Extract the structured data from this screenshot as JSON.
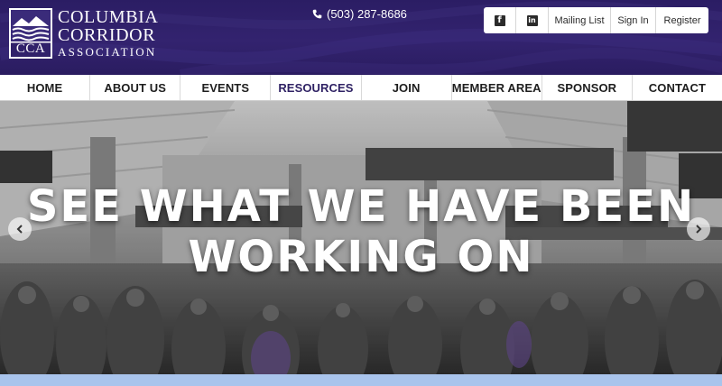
{
  "header": {
    "logo": {
      "abbr": "CCA",
      "line1": "COLUMBIA",
      "line2": "CORRIDOR",
      "line3": "ASSOCIATION"
    },
    "phone": "(503) 287-8686",
    "utility": {
      "facebook_icon": "facebook-icon",
      "linkedin_icon": "linkedin-icon",
      "mailing_list": "Mailing List",
      "sign_in": "Sign In",
      "register": "Register"
    }
  },
  "nav": {
    "items": [
      {
        "label": "HOME"
      },
      {
        "label": "ABOUT US"
      },
      {
        "label": "EVENTS"
      },
      {
        "label": "RESOURCES"
      },
      {
        "label": "JOIN"
      },
      {
        "label": "MEMBER AREA"
      },
      {
        "label": "SPONSOR"
      },
      {
        "label": "CONTACT"
      }
    ],
    "active": "RESOURCES"
  },
  "hero": {
    "title_line1": "SEE WHAT WE HAVE BEEN",
    "title_line2": "WORKING ON",
    "prev_icon": "chevron-left-icon",
    "next_icon": "chevron-right-icon"
  },
  "colors": {
    "header_bg": "#2f2167",
    "accent": "#2f2264",
    "bottom_strip": "#a9c4ec"
  }
}
